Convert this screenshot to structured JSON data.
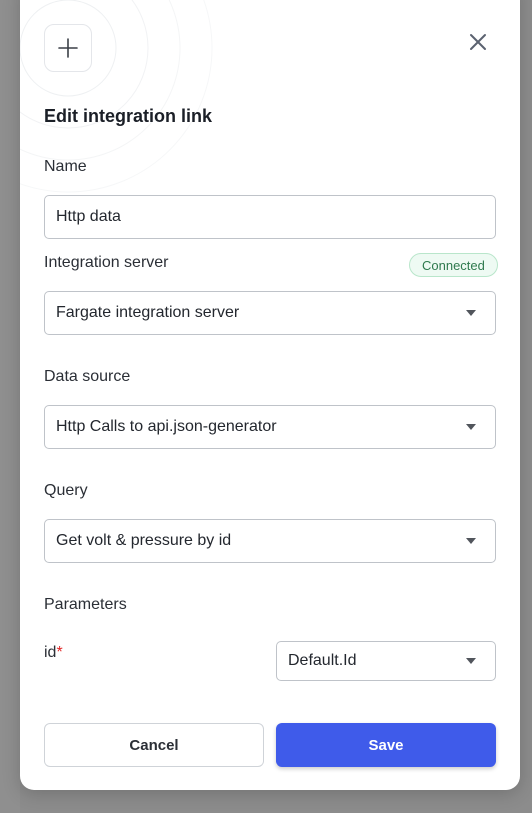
{
  "dialog": {
    "title": "Edit integration link",
    "icon": "plus-icon",
    "close_icon": "close-icon"
  },
  "form": {
    "name": {
      "label": "Name",
      "value": "Http data"
    },
    "integration_server": {
      "label": "Integration server",
      "status": "Connected",
      "value": "Fargate integration server"
    },
    "data_source": {
      "label": "Data source",
      "value": "Http Calls to api.json-generator"
    },
    "query": {
      "label": "Query",
      "value": "Get volt & pressure by id"
    },
    "parameters": {
      "label": "Parameters",
      "items": [
        {
          "name": "id",
          "required_marker": "*",
          "value": "Default.Id"
        }
      ]
    }
  },
  "actions": {
    "cancel_label": "Cancel",
    "save_label": "Save"
  },
  "colors": {
    "primary": "#3f5bea",
    "success_bg": "#eefaf3",
    "success_text": "#2f7a4e",
    "required": "#e02424"
  }
}
